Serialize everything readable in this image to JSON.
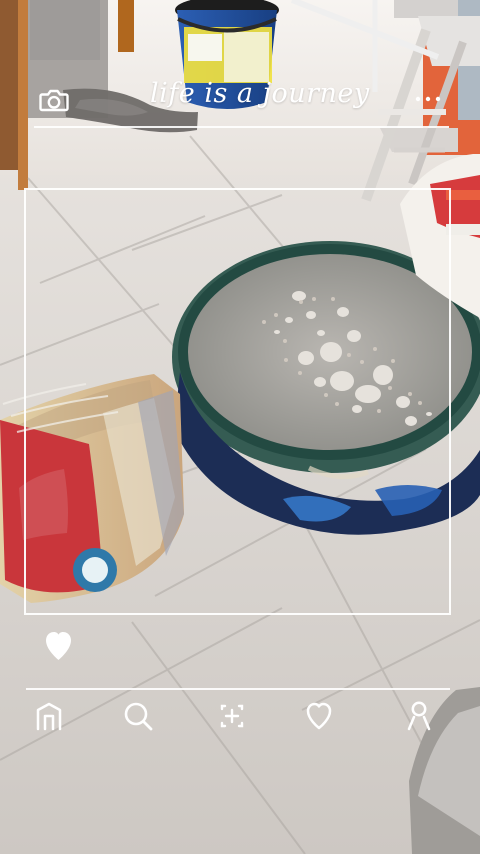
{
  "header": {
    "title": "life is a journey",
    "left_icon": "camera-icon",
    "right_icon": "more-icon"
  },
  "actions": {
    "like_icon": "heart-filled-icon"
  },
  "bottom_nav": {
    "items": [
      {
        "icon": "home-icon"
      },
      {
        "icon": "search-icon"
      },
      {
        "icon": "add-icon"
      },
      {
        "icon": "heart-icon"
      },
      {
        "icon": "profile-icon"
      }
    ]
  },
  "colors": {
    "overlay": "#ffffff",
    "floor": "#d9d6d2",
    "accent_orange": "#e2643b",
    "bag_red": "#c8343a",
    "bag_tan": "#d7bc8d",
    "sieve_green": "#274f46"
  }
}
